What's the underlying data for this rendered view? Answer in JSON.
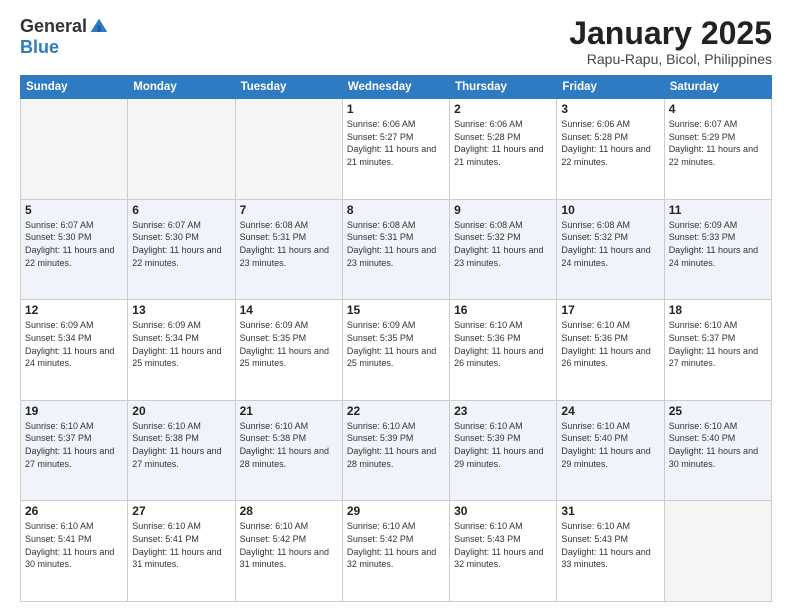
{
  "header": {
    "logo_general": "General",
    "logo_blue": "Blue",
    "month_title": "January 2025",
    "location": "Rapu-Rapu, Bicol, Philippines"
  },
  "weekdays": [
    "Sunday",
    "Monday",
    "Tuesday",
    "Wednesday",
    "Thursday",
    "Friday",
    "Saturday"
  ],
  "weeks": [
    [
      {
        "day": "",
        "sunrise": "",
        "sunset": "",
        "daylight": "",
        "empty": true
      },
      {
        "day": "",
        "sunrise": "",
        "sunset": "",
        "daylight": "",
        "empty": true
      },
      {
        "day": "",
        "sunrise": "",
        "sunset": "",
        "daylight": "",
        "empty": true
      },
      {
        "day": "1",
        "sunrise": "Sunrise: 6:06 AM",
        "sunset": "Sunset: 5:27 PM",
        "daylight": "Daylight: 11 hours and 21 minutes."
      },
      {
        "day": "2",
        "sunrise": "Sunrise: 6:06 AM",
        "sunset": "Sunset: 5:28 PM",
        "daylight": "Daylight: 11 hours and 21 minutes."
      },
      {
        "day": "3",
        "sunrise": "Sunrise: 6:06 AM",
        "sunset": "Sunset: 5:28 PM",
        "daylight": "Daylight: 11 hours and 22 minutes."
      },
      {
        "day": "4",
        "sunrise": "Sunrise: 6:07 AM",
        "sunset": "Sunset: 5:29 PM",
        "daylight": "Daylight: 11 hours and 22 minutes."
      }
    ],
    [
      {
        "day": "5",
        "sunrise": "Sunrise: 6:07 AM",
        "sunset": "Sunset: 5:30 PM",
        "daylight": "Daylight: 11 hours and 22 minutes."
      },
      {
        "day": "6",
        "sunrise": "Sunrise: 6:07 AM",
        "sunset": "Sunset: 5:30 PM",
        "daylight": "Daylight: 11 hours and 22 minutes."
      },
      {
        "day": "7",
        "sunrise": "Sunrise: 6:08 AM",
        "sunset": "Sunset: 5:31 PM",
        "daylight": "Daylight: 11 hours and 23 minutes."
      },
      {
        "day": "8",
        "sunrise": "Sunrise: 6:08 AM",
        "sunset": "Sunset: 5:31 PM",
        "daylight": "Daylight: 11 hours and 23 minutes."
      },
      {
        "day": "9",
        "sunrise": "Sunrise: 6:08 AM",
        "sunset": "Sunset: 5:32 PM",
        "daylight": "Daylight: 11 hours and 23 minutes."
      },
      {
        "day": "10",
        "sunrise": "Sunrise: 6:08 AM",
        "sunset": "Sunset: 5:32 PM",
        "daylight": "Daylight: 11 hours and 24 minutes."
      },
      {
        "day": "11",
        "sunrise": "Sunrise: 6:09 AM",
        "sunset": "Sunset: 5:33 PM",
        "daylight": "Daylight: 11 hours and 24 minutes."
      }
    ],
    [
      {
        "day": "12",
        "sunrise": "Sunrise: 6:09 AM",
        "sunset": "Sunset: 5:34 PM",
        "daylight": "Daylight: 11 hours and 24 minutes."
      },
      {
        "day": "13",
        "sunrise": "Sunrise: 6:09 AM",
        "sunset": "Sunset: 5:34 PM",
        "daylight": "Daylight: 11 hours and 25 minutes."
      },
      {
        "day": "14",
        "sunrise": "Sunrise: 6:09 AM",
        "sunset": "Sunset: 5:35 PM",
        "daylight": "Daylight: 11 hours and 25 minutes."
      },
      {
        "day": "15",
        "sunrise": "Sunrise: 6:09 AM",
        "sunset": "Sunset: 5:35 PM",
        "daylight": "Daylight: 11 hours and 25 minutes."
      },
      {
        "day": "16",
        "sunrise": "Sunrise: 6:10 AM",
        "sunset": "Sunset: 5:36 PM",
        "daylight": "Daylight: 11 hours and 26 minutes."
      },
      {
        "day": "17",
        "sunrise": "Sunrise: 6:10 AM",
        "sunset": "Sunset: 5:36 PM",
        "daylight": "Daylight: 11 hours and 26 minutes."
      },
      {
        "day": "18",
        "sunrise": "Sunrise: 6:10 AM",
        "sunset": "Sunset: 5:37 PM",
        "daylight": "Daylight: 11 hours and 27 minutes."
      }
    ],
    [
      {
        "day": "19",
        "sunrise": "Sunrise: 6:10 AM",
        "sunset": "Sunset: 5:37 PM",
        "daylight": "Daylight: 11 hours and 27 minutes."
      },
      {
        "day": "20",
        "sunrise": "Sunrise: 6:10 AM",
        "sunset": "Sunset: 5:38 PM",
        "daylight": "Daylight: 11 hours and 27 minutes."
      },
      {
        "day": "21",
        "sunrise": "Sunrise: 6:10 AM",
        "sunset": "Sunset: 5:38 PM",
        "daylight": "Daylight: 11 hours and 28 minutes."
      },
      {
        "day": "22",
        "sunrise": "Sunrise: 6:10 AM",
        "sunset": "Sunset: 5:39 PM",
        "daylight": "Daylight: 11 hours and 28 minutes."
      },
      {
        "day": "23",
        "sunrise": "Sunrise: 6:10 AM",
        "sunset": "Sunset: 5:39 PM",
        "daylight": "Daylight: 11 hours and 29 minutes."
      },
      {
        "day": "24",
        "sunrise": "Sunrise: 6:10 AM",
        "sunset": "Sunset: 5:40 PM",
        "daylight": "Daylight: 11 hours and 29 minutes."
      },
      {
        "day": "25",
        "sunrise": "Sunrise: 6:10 AM",
        "sunset": "Sunset: 5:40 PM",
        "daylight": "Daylight: 11 hours and 30 minutes."
      }
    ],
    [
      {
        "day": "26",
        "sunrise": "Sunrise: 6:10 AM",
        "sunset": "Sunset: 5:41 PM",
        "daylight": "Daylight: 11 hours and 30 minutes."
      },
      {
        "day": "27",
        "sunrise": "Sunrise: 6:10 AM",
        "sunset": "Sunset: 5:41 PM",
        "daylight": "Daylight: 11 hours and 31 minutes."
      },
      {
        "day": "28",
        "sunrise": "Sunrise: 6:10 AM",
        "sunset": "Sunset: 5:42 PM",
        "daylight": "Daylight: 11 hours and 31 minutes."
      },
      {
        "day": "29",
        "sunrise": "Sunrise: 6:10 AM",
        "sunset": "Sunset: 5:42 PM",
        "daylight": "Daylight: 11 hours and 32 minutes."
      },
      {
        "day": "30",
        "sunrise": "Sunrise: 6:10 AM",
        "sunset": "Sunset: 5:43 PM",
        "daylight": "Daylight: 11 hours and 32 minutes."
      },
      {
        "day": "31",
        "sunrise": "Sunrise: 6:10 AM",
        "sunset": "Sunset: 5:43 PM",
        "daylight": "Daylight: 11 hours and 33 minutes."
      },
      {
        "day": "",
        "sunrise": "",
        "sunset": "",
        "daylight": "",
        "empty": true
      }
    ]
  ]
}
